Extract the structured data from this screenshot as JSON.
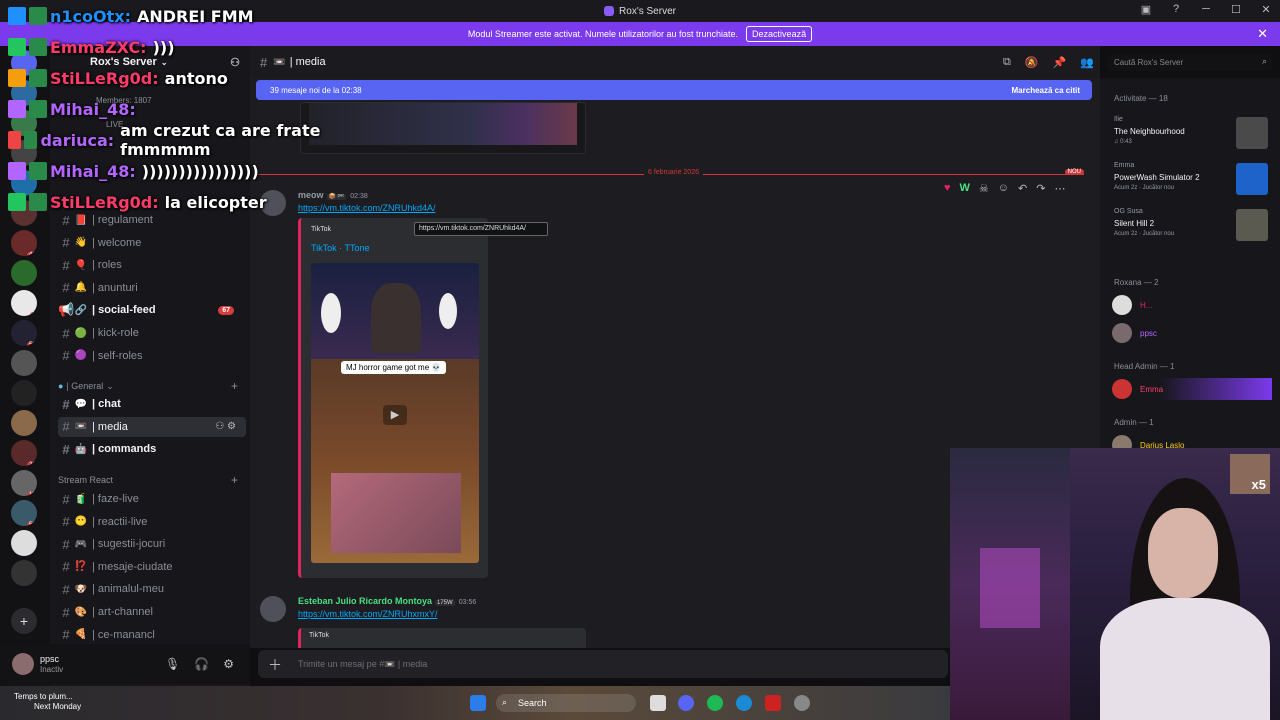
{
  "window": {
    "title": "Rox's Server"
  },
  "banner": {
    "text": "Modul Streamer este activat. Numele utilizatorilor au fost trunchiate.",
    "button": "Dezactivează"
  },
  "server": {
    "name": "Rox's Server"
  },
  "channels": [
    {
      "name": "| regulament",
      "emoji": "📕",
      "state": "normal",
      "kind": "text"
    },
    {
      "name": "| welcome",
      "emoji": "👋",
      "state": "normal",
      "kind": "text"
    },
    {
      "name": "| roles",
      "emoji": "🎈",
      "state": "normal",
      "kind": "text"
    },
    {
      "name": "| anunturi",
      "emoji": "🔔",
      "state": "normal",
      "kind": "text"
    },
    {
      "name": "| social-feed",
      "emoji": "🔗",
      "state": "unread",
      "badge": "67",
      "kind": "announce"
    },
    {
      "name": "| kick-role",
      "emoji": "🟢",
      "state": "normal",
      "kind": "text"
    },
    {
      "name": "| self-roles",
      "emoji": "🟣",
      "state": "normal",
      "kind": "text"
    }
  ],
  "categories": {
    "general": "| General",
    "stream_react": "Stream React"
  },
  "general_channels": [
    {
      "name": "| chat",
      "emoji": "💬",
      "state": "unread"
    },
    {
      "name": "| media",
      "emoji": "📼",
      "state": "active"
    },
    {
      "name": "| commands",
      "emoji": "🤖",
      "state": "unread"
    }
  ],
  "stream_channels": [
    {
      "name": "| faze-live",
      "emoji": "🧃"
    },
    {
      "name": "| reactii-live",
      "emoji": "😶"
    },
    {
      "name": "| sugestii-jocuri",
      "emoji": "🎮"
    },
    {
      "name": "| mesaje-ciudate",
      "emoji": "⁉️"
    },
    {
      "name": "| animalul-meu",
      "emoji": "🐶"
    },
    {
      "name": "| art-channel",
      "emoji": "🎨"
    },
    {
      "name": "| ce-manancl",
      "emoji": "🍕"
    }
  ],
  "user": {
    "name": "ppsc",
    "status": "Inactiv"
  },
  "chat": {
    "channel": "| media",
    "search_placeholder": "Caută Rox's Server",
    "new_messages": "39 mesaje noi de la 02:38",
    "mark_read": "Marchează ca citit",
    "date_divider": "6 februarie 2026",
    "new_tag": "NOU",
    "composer_placeholder": "Trimite un mesaj pe #📼 | media"
  },
  "messages": [
    {
      "author": "meow",
      "tag": "📦 ᵖᵃᶜ",
      "time": "02:38",
      "link": "https://vm.tiktok.com/ZNRUhkd4A/",
      "embed_provider": "TikTok",
      "embed_title": "TikTok · TTone",
      "video_caption": "MJ horror game got me 💀",
      "tooltip": "https://vm.tiktok.com/ZNRUhkd4A/"
    },
    {
      "author": "Esteban Julio Ricardo Montoya",
      "tag": "175W",
      "time": "03:56",
      "link": "https://vm.tiktok.com/ZNRUhxmxY/",
      "embed_provider": "TikTok"
    }
  ],
  "members": {
    "activity_header": "Activitate — 18",
    "activities": [
      {
        "name": "Ilie",
        "game": "The Neighbourhood",
        "meta": "♫ 0:43",
        "color": "#4a4a4a"
      },
      {
        "name": "Emma",
        "game": "PowerWash Simulator 2",
        "meta": "Acum 2z · Jucător nou",
        "color": "#1e63c9"
      },
      {
        "name": "OG Susa",
        "game": "Silent Hill 2",
        "meta": "Acum 2z · Jucător nou",
        "color": "#5a5a50"
      }
    ],
    "roxana_header": "Roxana — 2",
    "roxana": [
      {
        "name": "H..."
      },
      {
        "name": "ppsc"
      }
    ],
    "headadmin_header": "Head Admin — 1",
    "headadmin": [
      {
        "name": "Emma"
      }
    ],
    "admin_header": "Admin — 1",
    "admin": [
      {
        "name": "Darius Laslo"
      }
    ]
  },
  "overlay": [
    {
      "name": "n1coOtx:",
      "text": "ANDREI FMM",
      "color": "#1e90ff"
    },
    {
      "name": "EmmaZXC:",
      "text": ")))",
      "color": "#ff3b6b"
    },
    {
      "name": "StiLLeRg0d:",
      "text": "antono",
      "color": "#ff3b6b"
    },
    {
      "name": "Mihai_48:",
      "text": "",
      "color": "#b266ff"
    },
    {
      "name": "dariuca:",
      "text": "am crezut ca are frate fmmmmm",
      "color": "#b266ff"
    },
    {
      "name": "Mihai_48:",
      "text": "))))))))))))))))",
      "color": "#b266ff"
    },
    {
      "name": "StiLLeRg0d:",
      "text": "la elicopter",
      "color": "#ff3b6b"
    }
  ],
  "taskbar": {
    "weather": "Temps to plum...",
    "weather_sub": "Next Monday",
    "search": "Search"
  },
  "cam": {
    "badge": "x5"
  },
  "members_small": {
    "members_count": "Members: 1807",
    "live": "LIVE"
  }
}
